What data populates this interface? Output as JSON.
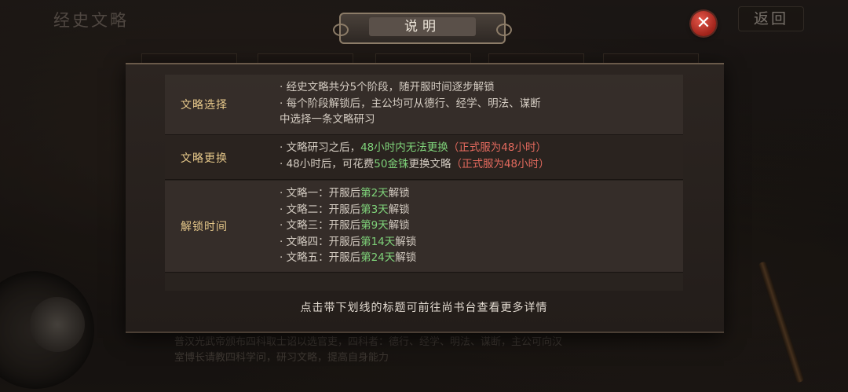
{
  "background": {
    "title": "经史文略",
    "back_label": "返回",
    "close_icon_glyph": "✕",
    "description_lines": [
      "普汉光武帝颁布四科取士诏以选官吏，四科者：德行、经学、明法、谋断，主公可向汉",
      "室博长请教四科学问，研习文略，提高自身能力"
    ]
  },
  "dialog": {
    "title": "说明",
    "sections": [
      {
        "label": "文略选择",
        "lines": [
          [
            {
              "t": "· ",
              "c": ""
            },
            {
              "t": "经史文略共分5个阶段，随开服时间逐步解锁",
              "c": ""
            }
          ],
          [
            {
              "t": "· ",
              "c": ""
            },
            {
              "t": "每个阶段解锁后，主公均可从德行、经学、明法、谋断",
              "c": ""
            }
          ],
          [
            {
              "t": "中选择一条文略研习",
              "c": ""
            }
          ]
        ]
      },
      {
        "label": "文略更换",
        "lines": [
          [
            {
              "t": "· ",
              "c": ""
            },
            {
              "t": "文略研习之后，",
              "c": ""
            },
            {
              "t": "48小时内无法更换",
              "c": "green"
            },
            {
              "t": "（正式服为48小时）",
              "c": "red"
            }
          ],
          [
            {
              "t": "· ",
              "c": ""
            },
            {
              "t": "48小时后，可花费",
              "c": ""
            },
            {
              "t": "50金铢",
              "c": "green"
            },
            {
              "t": "更换文略",
              "c": ""
            },
            {
              "t": "（正式服为48小时）",
              "c": "red"
            }
          ]
        ]
      },
      {
        "label": "解锁时间",
        "lines": [
          [
            {
              "t": "· ",
              "c": ""
            },
            {
              "t": "文略一：开服后",
              "c": ""
            },
            {
              "t": "第2天",
              "c": "green"
            },
            {
              "t": "解锁",
              "c": ""
            }
          ],
          [
            {
              "t": "· ",
              "c": ""
            },
            {
              "t": "文略二：开服后",
              "c": ""
            },
            {
              "t": "第3天",
              "c": "green"
            },
            {
              "t": "解锁",
              "c": ""
            }
          ],
          [
            {
              "t": "· ",
              "c": ""
            },
            {
              "t": "文略三：开服后",
              "c": ""
            },
            {
              "t": "第9天",
              "c": "green"
            },
            {
              "t": "解锁",
              "c": ""
            }
          ],
          [
            {
              "t": "· ",
              "c": ""
            },
            {
              "t": "文略四：开服后",
              "c": ""
            },
            {
              "t": "第14天",
              "c": "green"
            },
            {
              "t": "解锁",
              "c": ""
            }
          ],
          [
            {
              "t": "· ",
              "c": ""
            },
            {
              "t": "文略五：开服后",
              "c": ""
            },
            {
              "t": "第24天",
              "c": "green"
            },
            {
              "t": "解锁",
              "c": ""
            }
          ]
        ]
      }
    ],
    "footer_note": "点击带下划线的标题可前往尚书台查看更多详情"
  },
  "colors": {
    "highlight_green": "#7fd37a",
    "note_red": "#e46a5e",
    "label_gold": "#e6c88a"
  }
}
